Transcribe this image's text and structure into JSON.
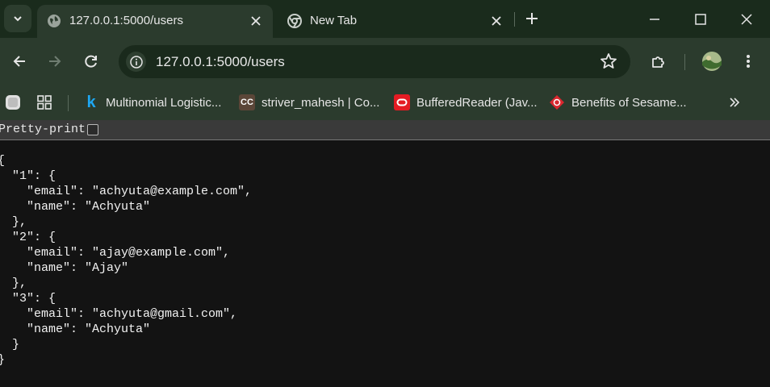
{
  "tabs": [
    {
      "title": "127.0.0.1:5000/users",
      "active": true
    },
    {
      "title": "New Tab",
      "active": false
    }
  ],
  "address_bar": {
    "url": "127.0.0.1:5000/users"
  },
  "bookmarks": [
    {
      "label": "Multinomial Logistic...",
      "icon": "k-letter-icon"
    },
    {
      "label": "striver_mahesh | Co...",
      "icon": "codechef-icon"
    },
    {
      "label": "BufferedReader (Jav...",
      "icon": "oracle-icon"
    },
    {
      "label": "Benefits of Sesame...",
      "icon": "diamond-icon"
    }
  ],
  "viewer": {
    "pretty_print_label": "Pretty-print",
    "pretty_print_checked": false,
    "json_text": "{\n  \"1\": {\n    \"email\": \"achyuta@example.com\",\n    \"name\": \"Achyuta\"\n  },\n  \"2\": {\n    \"email\": \"ajay@example.com\",\n    \"name\": \"Ajay\"\n  },\n  \"3\": {\n    \"email\": \"achyuta@gmail.com\",\n    \"name\": \"Achyuta\"\n  }\n}"
  },
  "colors": {
    "titlebar": "#1a2b1c",
    "toolbar": "#2b3b2d",
    "page_background": "#131313"
  }
}
